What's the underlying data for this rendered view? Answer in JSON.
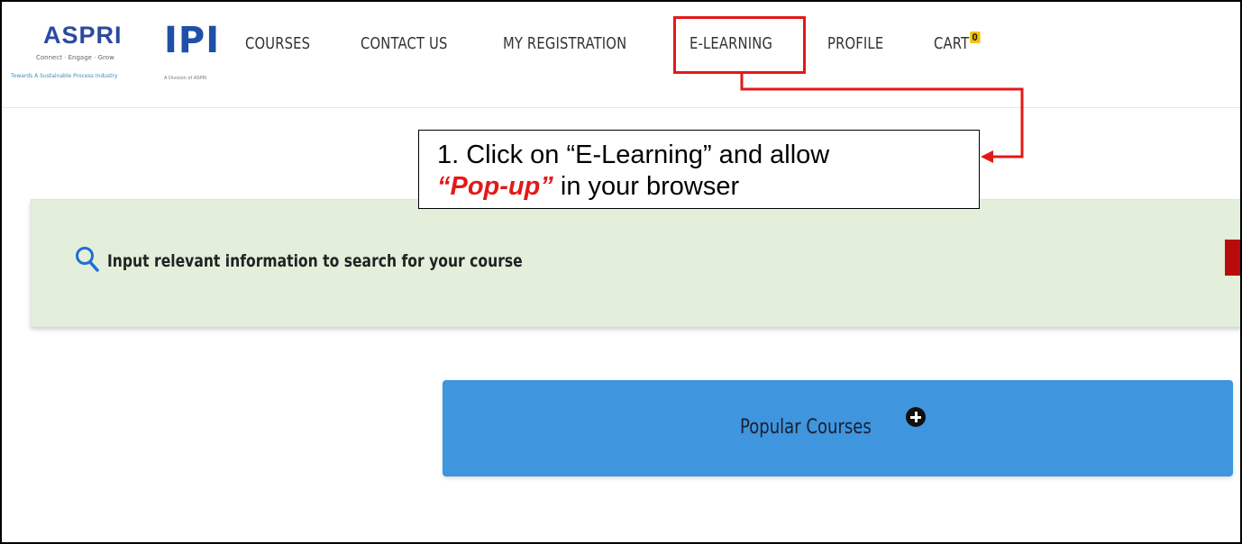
{
  "header": {
    "aspri_logo": {
      "wordmark": "ASPRI",
      "tagline": "Connect · Engage · Grow",
      "subline": "Towards A Sustainable Process Industry"
    },
    "ipi_logo": {
      "wordmark": "IPI",
      "subline": "A Division of ASPRI"
    },
    "nav": {
      "courses": "COURSES",
      "contact_us": "CONTACT US",
      "my_registration": "MY REGISTRATION",
      "e_learning": "E-LEARNING",
      "profile": "PROFILE",
      "cart": "CART",
      "cart_count": "0"
    }
  },
  "annotation": {
    "line1": "1. Click on “E-Learning” and allow",
    "emphasis": "“Pop-up”",
    "line2_rest": " in your browser",
    "highlight_color": "#e31919"
  },
  "search": {
    "prompt": "Input relevant information to search for your course",
    "icon": "search-icon"
  },
  "popular": {
    "label": "Popular Courses",
    "icon": "plus-circle-icon"
  },
  "colors": {
    "banner_bg": "#e3eedb",
    "popular_bg": "#3f95de",
    "accent_red": "#e31919"
  }
}
